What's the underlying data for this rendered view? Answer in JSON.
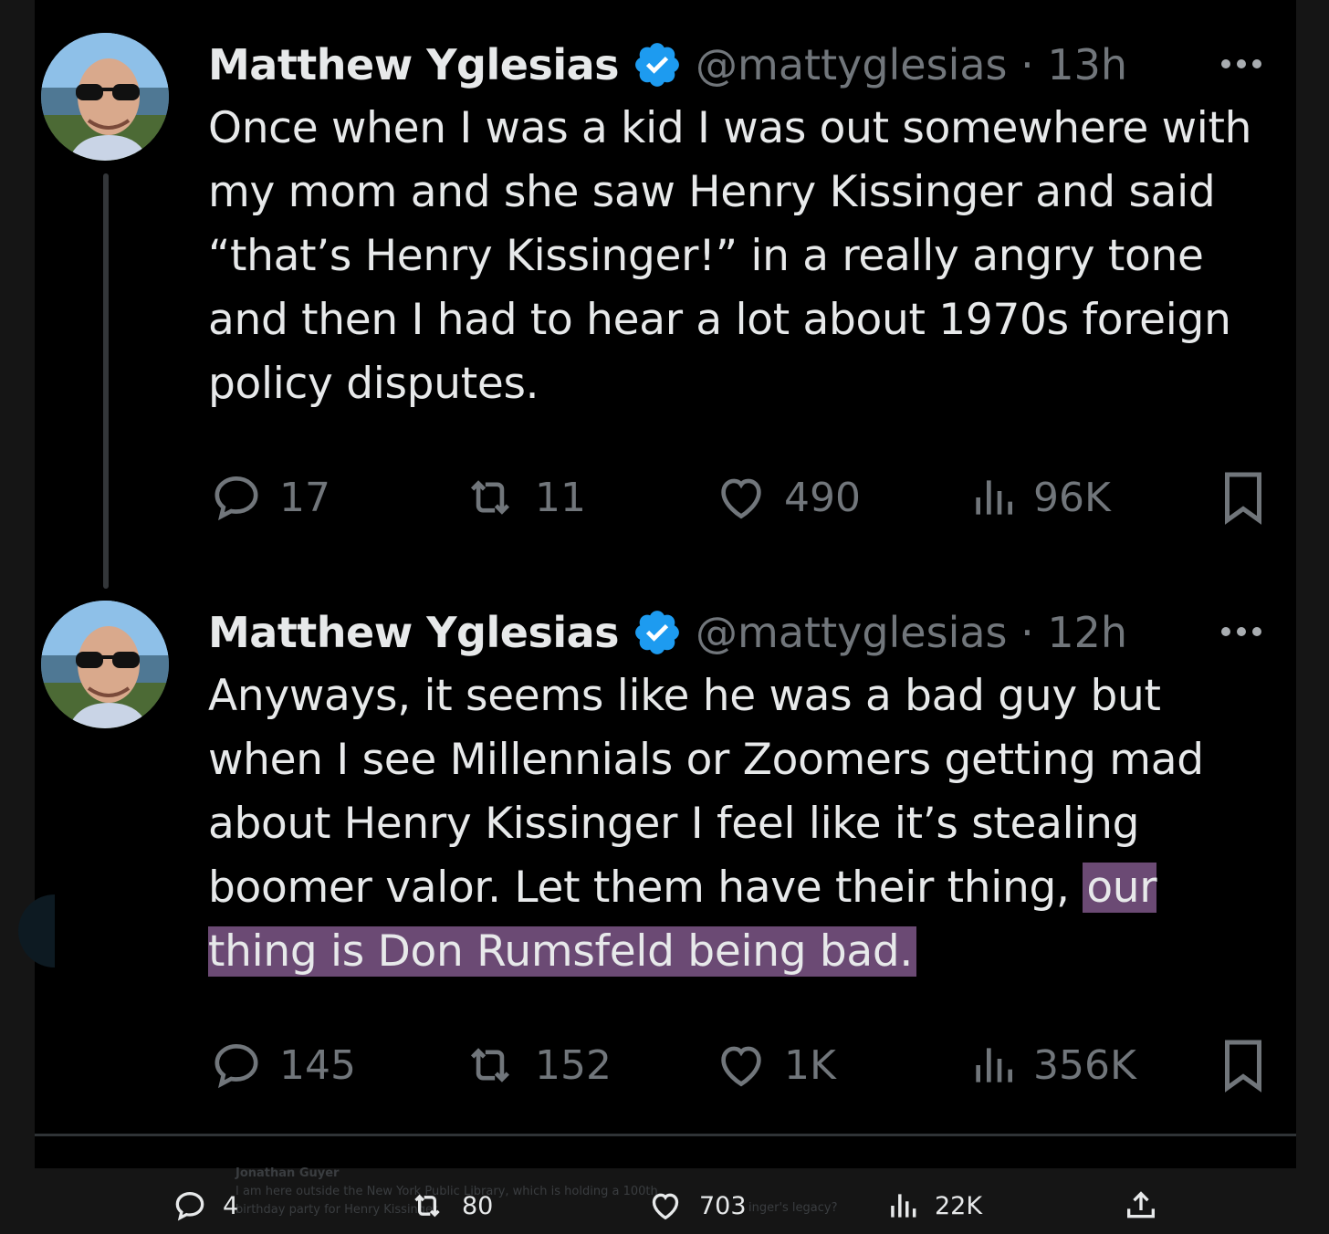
{
  "tweets": [
    {
      "author": "Matthew Yglesias",
      "handle": "@mattyglesias",
      "time": "13h",
      "meta": "@mattyglesias · 13h",
      "text": "Once when I was a kid I was out somewhere with my mom and she saw Henry Kissinger and said “that’s Henry Kissinger!” in a really angry tone and then I had to hear a lot about 1970s foreign policy disputes.",
      "stats": {
        "replies": "17",
        "reposts": "11",
        "likes": "490",
        "views": "96K"
      }
    },
    {
      "author": "Matthew Yglesias",
      "handle": "@mattyglesias",
      "time": "12h",
      "meta": "@mattyglesias · 12h",
      "text_plain": "Anyways, it seems like he was a bad guy but when I see Millennials or Zoomers getting mad about Henry Kissinger I feel like it’s stealing boomer valor. Let them have their thing, ",
      "text_highlight": "our thing is Don Rumsfeld being bad.",
      "stats": {
        "replies": "145",
        "reposts": "152",
        "likes": "1K",
        "views": "356K"
      }
    }
  ],
  "background_tweet": {
    "author": "Jonathan Guyer",
    "text_line1": "I am here outside the New York Public Library, which is holding a 100th",
    "text_line2": "birthday party for Henry Kissinger",
    "right_fragment": "inger's legacy?"
  },
  "bottom_bar": {
    "replies": "4",
    "reposts": "80",
    "likes": "703",
    "views": "22K"
  },
  "colors": {
    "background": "#000000",
    "text": "#e7e9ea",
    "muted": "#71767b",
    "verified": "#1d9bf0",
    "highlight": "#6b4a74"
  }
}
